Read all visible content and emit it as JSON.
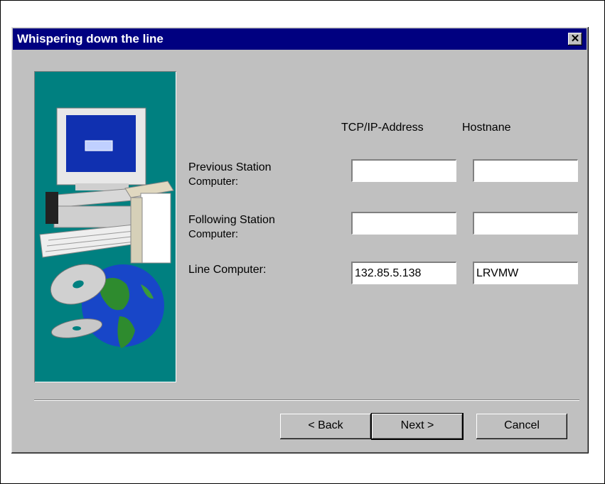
{
  "window": {
    "title": "Whispering down the line",
    "close_glyph": "✕"
  },
  "columns": {
    "address": "TCP/IP-Address",
    "hostname": "Hostnane"
  },
  "rows": [
    {
      "label_line1": "Previous Station",
      "label_line2": "Computer:",
      "address": "",
      "hostname": ""
    },
    {
      "label_line1": "Following Station",
      "label_line2": "Computer:",
      "address": "",
      "hostname": ""
    },
    {
      "label_line1": "Line Computer:",
      "label_line2": "",
      "address": "132.85.5.138",
      "hostname": "LRVMW"
    }
  ],
  "buttons": {
    "back": "< Back",
    "next": "Next >",
    "cancel": "Cancel"
  },
  "icons": {
    "illustration": "computer-globe-cd-illustration"
  },
  "colors": {
    "titlebar": "#000080",
    "dialog": "#c0c0c0",
    "illustration_bg": "#008080"
  }
}
